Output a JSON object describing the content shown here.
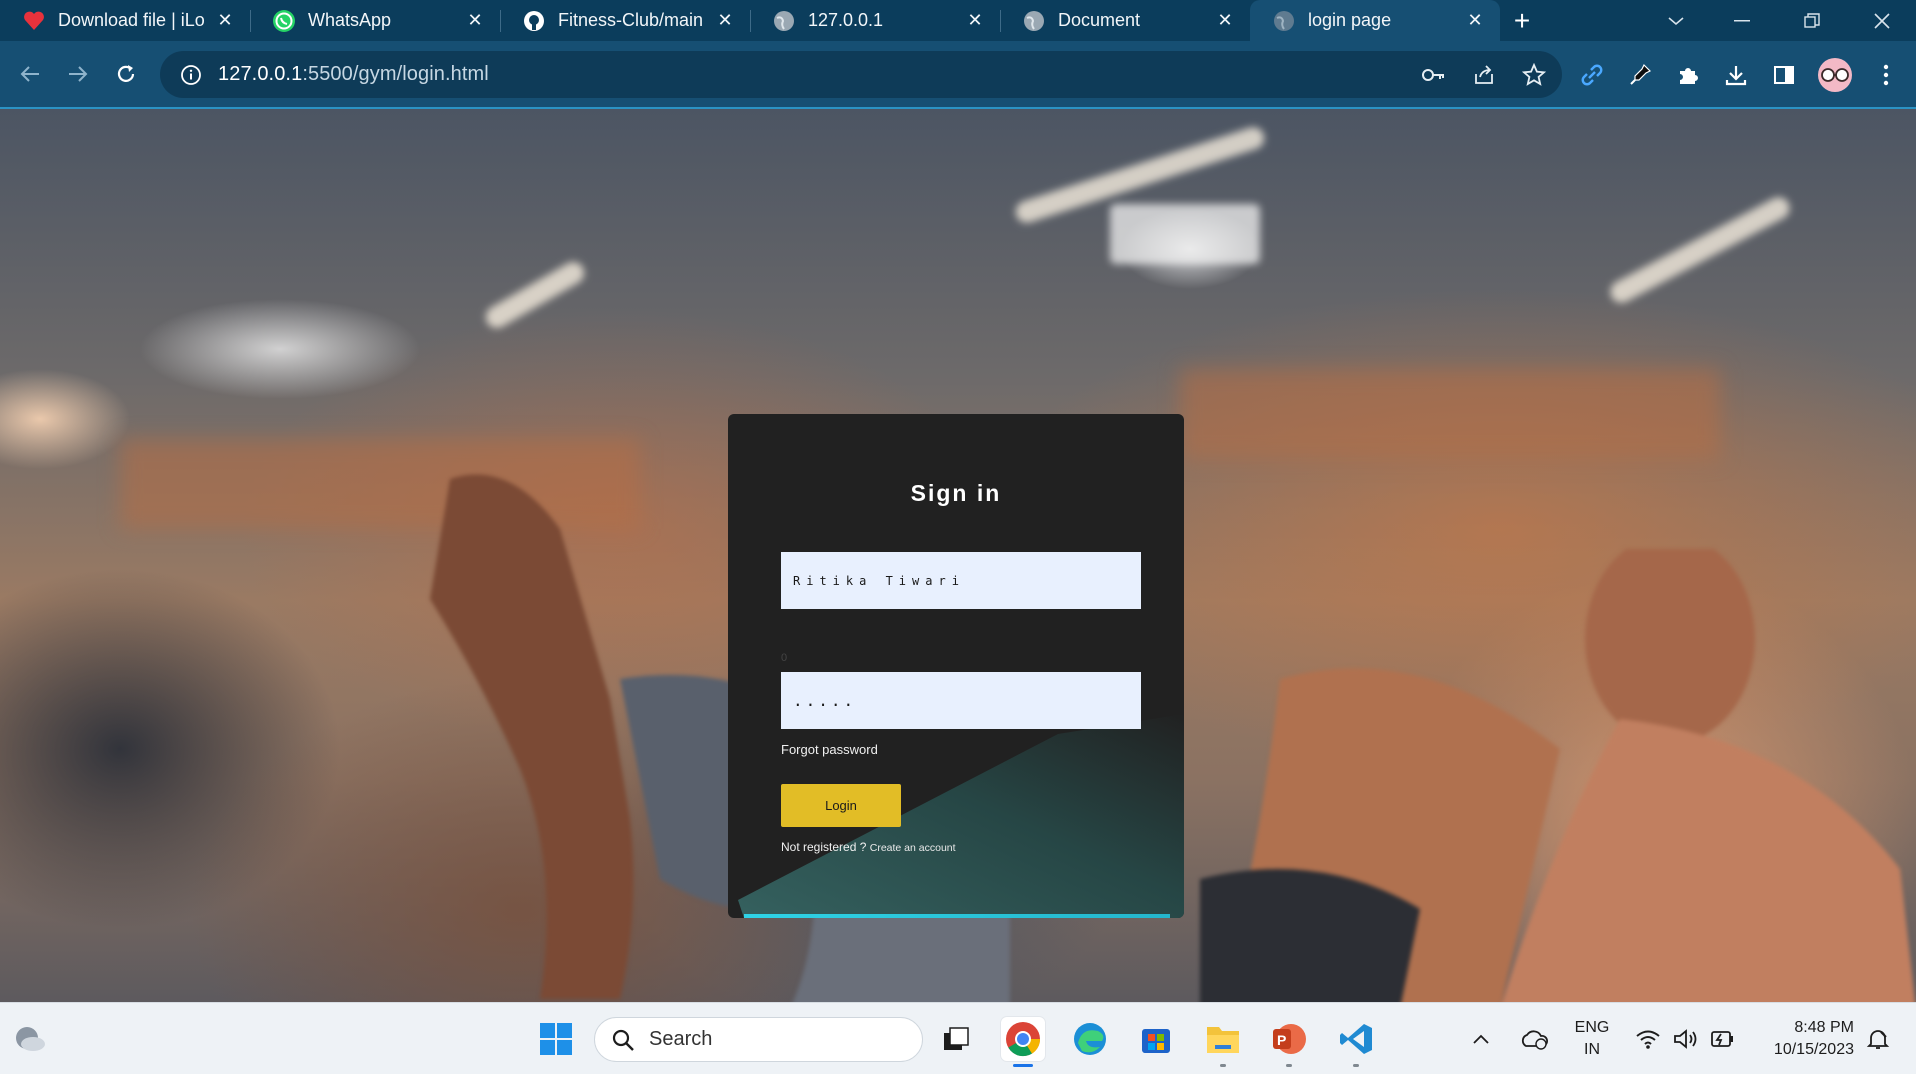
{
  "browser": {
    "tabs": [
      {
        "title": "Download file | iLo",
        "favicon": "heart-icon",
        "active": false
      },
      {
        "title": "WhatsApp",
        "favicon": "whatsapp-icon",
        "active": false
      },
      {
        "title": "Fitness-Club/main",
        "favicon": "github-icon",
        "active": false
      },
      {
        "title": "127.0.0.1",
        "favicon": "globe-icon",
        "active": false
      },
      {
        "title": "Document",
        "favicon": "globe-icon",
        "active": false
      },
      {
        "title": "login page",
        "favicon": "globe-icon",
        "active": true
      }
    ],
    "url_host": "127.0.0.1",
    "url_path": ":5500/gym/login.html"
  },
  "login": {
    "heading": "Sign in",
    "username_value": "Ritika Tiwari",
    "stray_label": "0",
    "password_value": ".....",
    "forgot_label": "Forgot password",
    "button_label": "Login",
    "not_registered": "Not registered ?",
    "create_account": "Create an account"
  },
  "taskbar": {
    "search_placeholder": "Search",
    "lang_line1": "ENG",
    "lang_line2": "IN",
    "time": "8:48 PM",
    "date": "10/15/2023"
  },
  "colors": {
    "browser_frame": "#0b3d5c",
    "toolbar": "#164f73",
    "card_bg": "#212121",
    "input_bg": "#e8f0fe",
    "login_button": "#e2bd26",
    "accent_line": "#2fd3e6"
  }
}
